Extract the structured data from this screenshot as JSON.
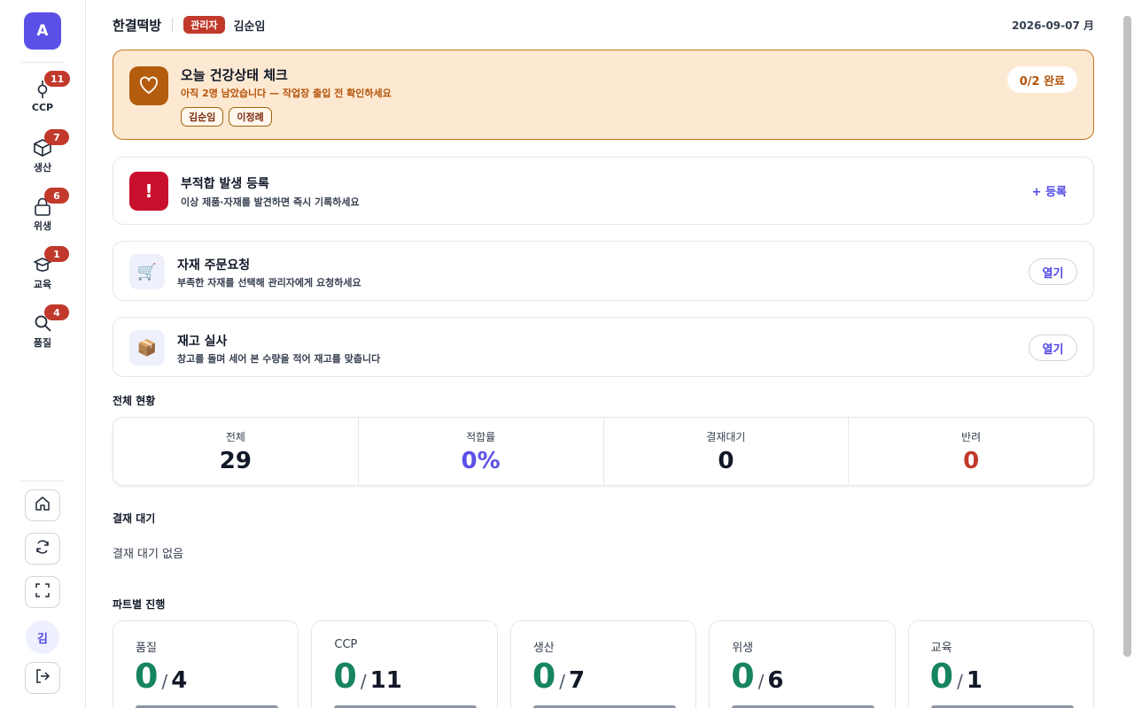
{
  "app": {
    "logo_letter": "A"
  },
  "sidebar": {
    "items": [
      {
        "label": "CCP",
        "badge": "11",
        "icon": "ccp-icon"
      },
      {
        "label": "생산",
        "badge": "7",
        "icon": "cube-icon"
      },
      {
        "label": "위생",
        "badge": "6",
        "icon": "lock-icon"
      },
      {
        "label": "교육",
        "badge": "1",
        "icon": "education-icon"
      },
      {
        "label": "품질",
        "badge": "4",
        "icon": "search-icon"
      }
    ],
    "avatar_initial": "김"
  },
  "header": {
    "team": "한결떡방",
    "role": "관리자",
    "user": "김순임",
    "date": "2026-09-07 月"
  },
  "health_check": {
    "title": "오늘 건강상태 체크",
    "subtitle": "아직 2명 남았습니다 — 작업장 출입 전 확인하세요",
    "people": [
      "김순임",
      "이정례"
    ],
    "status": "0/2 완료"
  },
  "nonconformance": {
    "icon_text": "!",
    "title": "부적합 발생 등록",
    "subtitle": "이상 제품·자재를 발견하면 즉시 기록하세요",
    "action": "+ 등록"
  },
  "material_order": {
    "title": "자재 주문요청",
    "subtitle": "부족한 자재를 선택해 관리자에게 요청하세요",
    "action": "열기"
  },
  "inventory": {
    "title": "재고 실사",
    "subtitle": "창고를 돌며 세어 본 수량을 적어 재고를 맞춥니다",
    "action": "열기"
  },
  "overview": {
    "title": "전체 현황",
    "stats": [
      {
        "label": "전체",
        "value": "29",
        "color": "#111827"
      },
      {
        "label": "적합률",
        "value": "0%",
        "color": "#5b50e6"
      },
      {
        "label": "결재대기",
        "value": "0",
        "color": "#111827"
      },
      {
        "label": "반려",
        "value": "0",
        "color": "#c0392b"
      }
    ]
  },
  "approval": {
    "title": "결재 대기",
    "empty": "결재 대기 없음"
  },
  "parts_progress": {
    "title": "파트별 진행",
    "parts": [
      {
        "name": "품질",
        "done": "0",
        "total": "4",
        "progress": 0
      },
      {
        "name": "CCP",
        "done": "0",
        "total": "11",
        "progress": 0
      },
      {
        "name": "생산",
        "done": "0",
        "total": "7",
        "progress": 0
      },
      {
        "name": "위생",
        "done": "0",
        "total": "6",
        "progress": 0
      },
      {
        "name": "교육",
        "done": "0",
        "total": "1",
        "progress": 0
      }
    ]
  },
  "colors": {
    "accent": "#5b50e6",
    "danger": "#c0392b",
    "success": "#17855d",
    "warning_bg": "#fde9d2"
  }
}
